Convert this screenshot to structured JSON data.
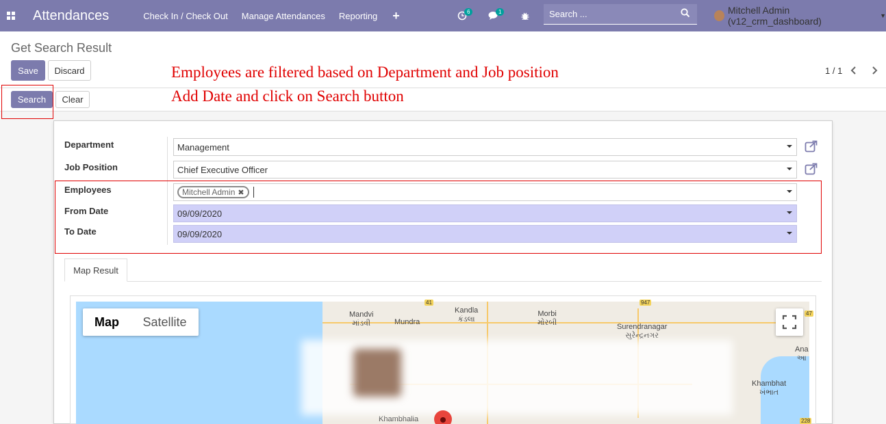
{
  "navbar": {
    "app_title": "Attendances",
    "menu": [
      "Check In / Check Out",
      "Manage Attendances",
      "Reporting"
    ],
    "activity_count": "6",
    "messages_count": "1",
    "search_placeholder": "Search ...",
    "user_name": "Mitchell Admin (v12_crm_dashboard)"
  },
  "control_panel": {
    "breadcrumb": "Get Search Result",
    "save_label": "Save",
    "discard_label": "Discard",
    "search_label": "Search",
    "clear_label": "Clear",
    "pager": "1 / 1"
  },
  "annotations": {
    "line1": "Employees are filtered based on Department and Job position",
    "line2": "Add Date and click on Search button"
  },
  "form": {
    "department_label": "Department",
    "department_value": "Management",
    "job_label": "Job Position",
    "job_value": "Chief Executive Officer",
    "employees_label": "Employees",
    "employee_tag": "Mitchell Admin",
    "from_label": "From Date",
    "from_value": "09/09/2020",
    "to_label": "To Date",
    "to_value": "09/09/2020"
  },
  "tab": {
    "label": "Map Result"
  },
  "map": {
    "map_label": "Map",
    "satellite_label": "Satellite",
    "places": [
      {
        "name": "Mandvi",
        "local": "માંડવી"
      },
      {
        "name": "Mundra",
        "local": ""
      },
      {
        "name": "Kandla",
        "local": "કંડલા"
      },
      {
        "name": "Morbi",
        "local": "મોરબી"
      },
      {
        "name": "Surendranagar",
        "local": "સુરેન્દ્રનગર"
      },
      {
        "name": "Ana",
        "local": "આ"
      },
      {
        "name": "Khambhat",
        "local": "ખંભાત"
      },
      {
        "name": "Khambhalia",
        "local": ""
      }
    ],
    "highways": [
      "41",
      "947",
      "47",
      "228"
    ]
  }
}
